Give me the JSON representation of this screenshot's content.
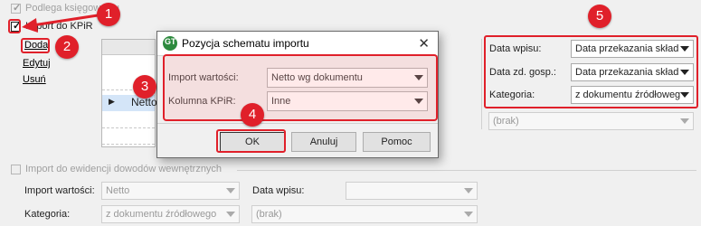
{
  "top": {
    "podlega_label": "Podlega księgowaniu",
    "import_kpir_label": "Import do KPiR"
  },
  "actions": {
    "dodaj": "Dodaj",
    "edytuj": "Edytuj",
    "usun": "Usuń"
  },
  "grid": {
    "row_text": "Netto"
  },
  "dialog": {
    "title": "Pozycja schematu importu",
    "import_label": "Import wartości:",
    "import_value": "Netto wg dokumentu",
    "kolumna_label": "Kolumna KPiR:",
    "kolumna_value": "Inne",
    "ok": "OK",
    "anuluj": "Anuluj",
    "pomoc": "Pomoc"
  },
  "right_panel": {
    "data_wpisu_label": "Data wpisu:",
    "data_wpisu_value": "Data przekazania skład",
    "data_zd_label": "Data zd. gosp.:",
    "data_zd_value": "Data przekazania skład",
    "kategoria_label": "Kategoria:",
    "kategoria_value": "z dokumentu źródłoweg",
    "brak_value": "(brak)"
  },
  "bottom": {
    "import_ewidencji_label": "Import do ewidencji dowodów wewnętrznych",
    "import_wartosci_label": "Import wartości:",
    "import_wartosci_value": "Netto",
    "data_wpisu_label": "Data wpisu:",
    "data_wpisu_value": "",
    "kategoria_label": "Kategoria:",
    "kategoria_value": "z dokumentu źródłowego",
    "brak_value": "(brak)"
  },
  "badges": [
    "1",
    "2",
    "3",
    "4",
    "5"
  ],
  "colors": {
    "highlight": "#e0202a",
    "selected_row": "#d4e5f8"
  }
}
